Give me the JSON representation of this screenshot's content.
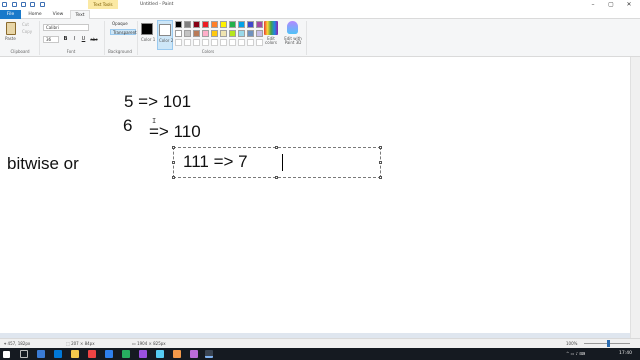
{
  "title": {
    "app_title": "Untitled - Paint",
    "context_tab": "Text Tools",
    "minimize": "–",
    "maximize": "▢",
    "close": "✕"
  },
  "tabs": {
    "file": "File",
    "home": "Home",
    "view": "View",
    "text": "Text"
  },
  "ribbon": {
    "clipboard": {
      "paste_label": "Paste",
      "cut_label": "Cut",
      "copy_label": "Copy",
      "group_label": "Clipboard"
    },
    "font": {
      "family": "Calibri",
      "size": "36",
      "bold": "B",
      "italic": "I",
      "underline": "U",
      "strike": "abc",
      "group_label": "Font"
    },
    "background": {
      "opaque": "Opaque",
      "transparent": "Transparent",
      "group_label": "Background"
    },
    "colors": {
      "color1_label": "Color 1",
      "color2_label": "Color 2",
      "edit_colors_label": "Edit colors",
      "paint3d_label": "Edit with Paint 3D",
      "group_label": "Colors",
      "color1": "#000000",
      "color2": "#ffffff",
      "palette_row1": [
        "#000000",
        "#7f7f7f",
        "#880015",
        "#ed1c24",
        "#ff7f27",
        "#fff200",
        "#22b14c",
        "#00a2e8",
        "#3f48cc",
        "#a349a4"
      ],
      "palette_row2": [
        "#ffffff",
        "#c3c3c3",
        "#b97a57",
        "#ffaec9",
        "#ffc90e",
        "#efe4b0",
        "#b5e61d",
        "#99d9ea",
        "#7092be",
        "#c8bfe7"
      ]
    }
  },
  "canvas": {
    "line1": "5   =>  101",
    "line2_left": "6",
    "line2_right": "=>  110",
    "label": "bitwise or",
    "editing_text": "111    =>   7"
  },
  "status": {
    "cursor_pos": "457, 182px",
    "selection_size": "207 × 84px",
    "image_size": "1904 × 825px",
    "zoom": "100%"
  },
  "taskbar": {
    "time": "17:40"
  }
}
